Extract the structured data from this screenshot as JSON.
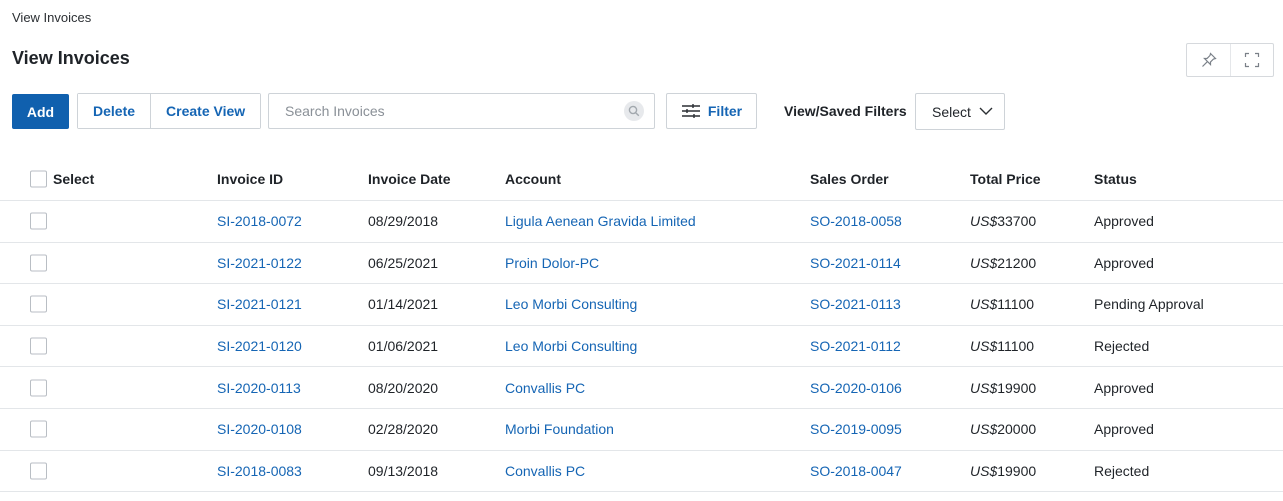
{
  "breadcrumb": "View Invoices",
  "page_title": "View Invoices",
  "toolbar": {
    "add_label": "Add",
    "delete_label": "Delete",
    "create_view_label": "Create View",
    "search_placeholder": "Search Invoices",
    "filter_label": "Filter",
    "saved_filters_label": "View/Saved Filters",
    "select_value": "Select"
  },
  "colors": {
    "accent": "#1060ae",
    "link": "#1565b4"
  },
  "icons": [
    "pin-icon",
    "expand-icon",
    "search-icon",
    "filter-sliders-icon",
    "chevron-down-icon"
  ],
  "table": {
    "headers": {
      "select": "Select",
      "invoice_id": "Invoice ID",
      "invoice_date": "Invoice Date",
      "account": "Account",
      "sales_order": "Sales Order",
      "total_price": "Total Price",
      "status": "Status"
    },
    "rows": [
      {
        "invoice_id": "SI-2018-0072",
        "invoice_date": "08/29/2018",
        "account": "Ligula Aenean Gravida Limited",
        "sales_order": "SO-2018-0058",
        "currency": "US$",
        "amount": "33700",
        "status": "Approved"
      },
      {
        "invoice_id": "SI-2021-0122",
        "invoice_date": "06/25/2021",
        "account": "Proin Dolor-PC",
        "sales_order": "SO-2021-0114",
        "currency": "US$",
        "amount": "21200",
        "status": "Approved"
      },
      {
        "invoice_id": "SI-2021-0121",
        "invoice_date": "01/14/2021",
        "account": "Leo Morbi Consulting",
        "sales_order": "SO-2021-0113",
        "currency": "US$",
        "amount": "11100",
        "status": "Pending Approval"
      },
      {
        "invoice_id": "SI-2021-0120",
        "invoice_date": "01/06/2021",
        "account": "Leo Morbi Consulting",
        "sales_order": "SO-2021-0112",
        "currency": "US$",
        "amount": "11100",
        "status": "Rejected"
      },
      {
        "invoice_id": "SI-2020-0113",
        "invoice_date": "08/20/2020",
        "account": "Convallis PC",
        "sales_order": "SO-2020-0106",
        "currency": "US$",
        "amount": "19900",
        "status": "Approved"
      },
      {
        "invoice_id": "SI-2020-0108",
        "invoice_date": "02/28/2020",
        "account": "Morbi Foundation",
        "sales_order": "SO-2019-0095",
        "currency": "US$",
        "amount": "20000",
        "status": "Approved"
      },
      {
        "invoice_id": "SI-2018-0083",
        "invoice_date": "09/13/2018",
        "account": "Convallis PC",
        "sales_order": "SO-2018-0047",
        "currency": "US$",
        "amount": "19900",
        "status": "Rejected"
      }
    ]
  }
}
